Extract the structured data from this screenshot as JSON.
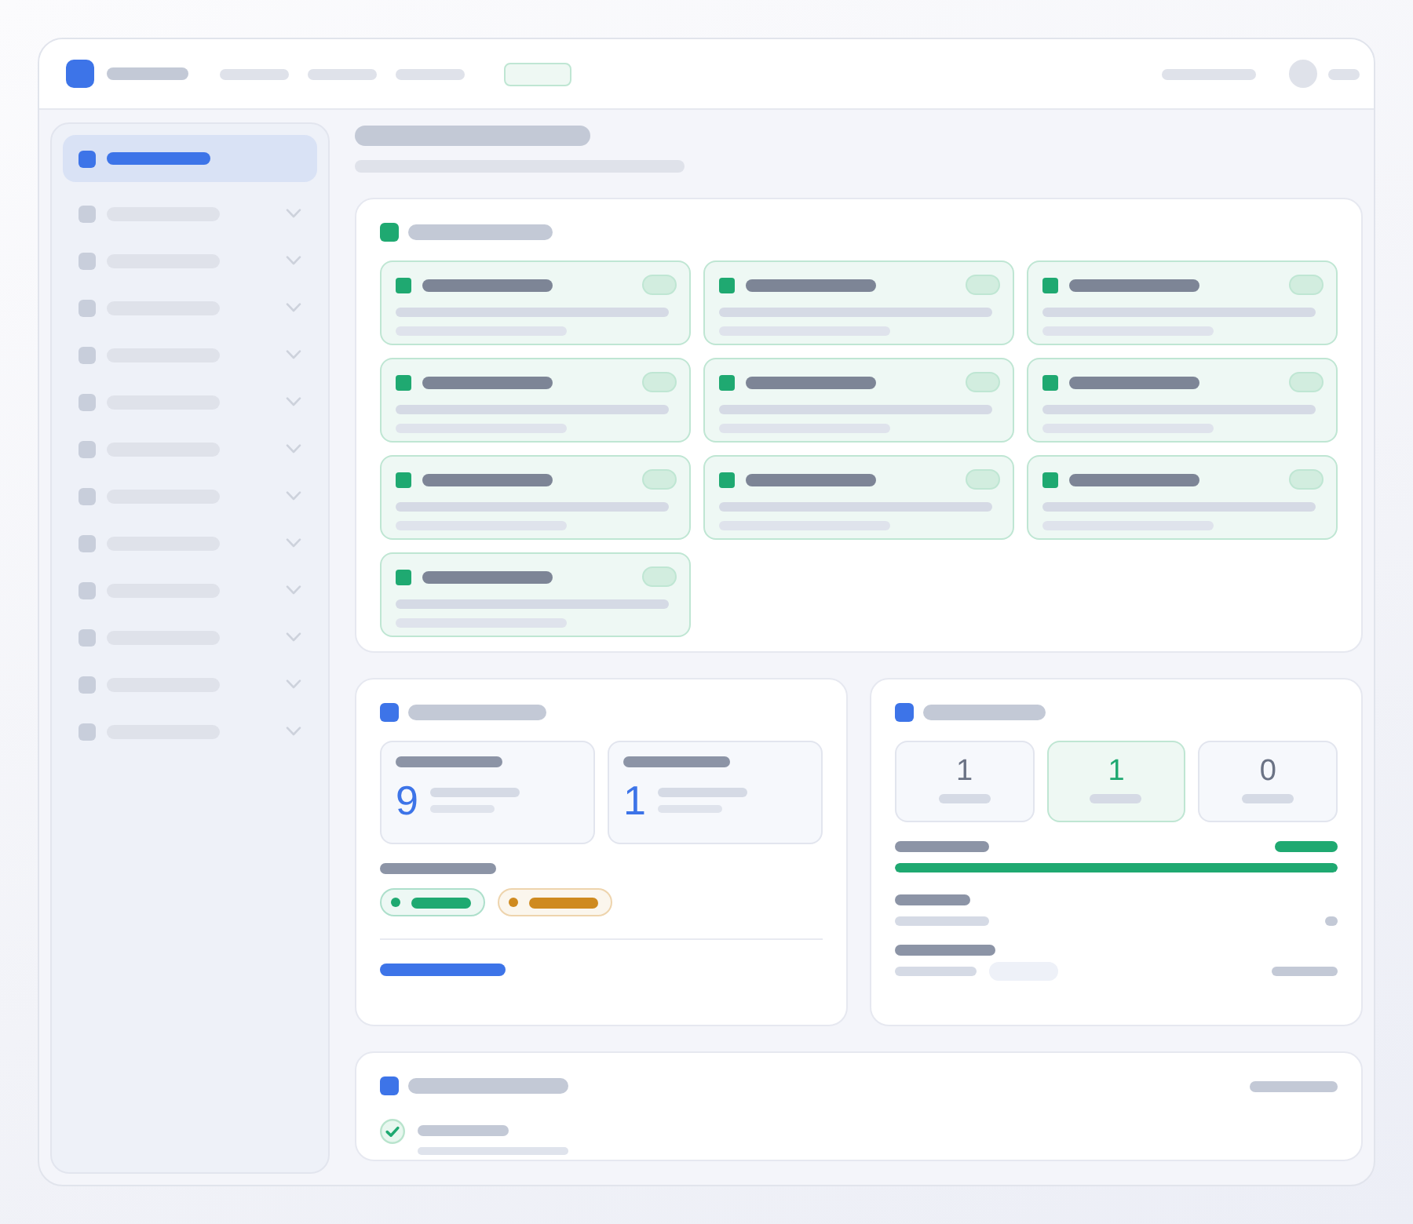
{
  "sidebar": {
    "items": [
      {
        "kind": "link",
        "selected": true
      },
      {
        "kind": "group",
        "selected": false
      },
      {
        "kind": "group",
        "selected": false
      },
      {
        "kind": "group",
        "selected": false
      },
      {
        "kind": "group",
        "selected": false
      },
      {
        "kind": "group",
        "selected": false
      },
      {
        "kind": "group",
        "selected": false
      },
      {
        "kind": "group",
        "selected": false
      },
      {
        "kind": "group",
        "selected": false
      },
      {
        "kind": "group",
        "selected": false
      },
      {
        "kind": "group",
        "selected": false
      },
      {
        "kind": "group",
        "selected": false
      },
      {
        "kind": "group",
        "selected": false
      }
    ]
  },
  "overview": {
    "tiles": [
      {
        "kind": "success"
      },
      {
        "kind": "success"
      },
      {
        "kind": "success"
      },
      {
        "kind": "success"
      },
      {
        "kind": "success"
      },
      {
        "kind": "success"
      },
      {
        "kind": "success"
      },
      {
        "kind": "success"
      },
      {
        "kind": "success"
      },
      {
        "kind": "success"
      }
    ]
  },
  "summary": {
    "stats": [
      {
        "value": "9"
      },
      {
        "value": "1"
      }
    ],
    "chips": [
      {
        "color": "#1fa971"
      },
      {
        "color": "#cf8a1f"
      }
    ]
  },
  "counts_panel": {
    "counts": [
      {
        "value": "1",
        "selected": false
      },
      {
        "value": "1",
        "selected": true
      },
      {
        "value": "0",
        "selected": false
      }
    ],
    "progress": {
      "level": 1
    }
  },
  "checklist": {
    "items": [
      {
        "done": true
      }
    ]
  }
}
